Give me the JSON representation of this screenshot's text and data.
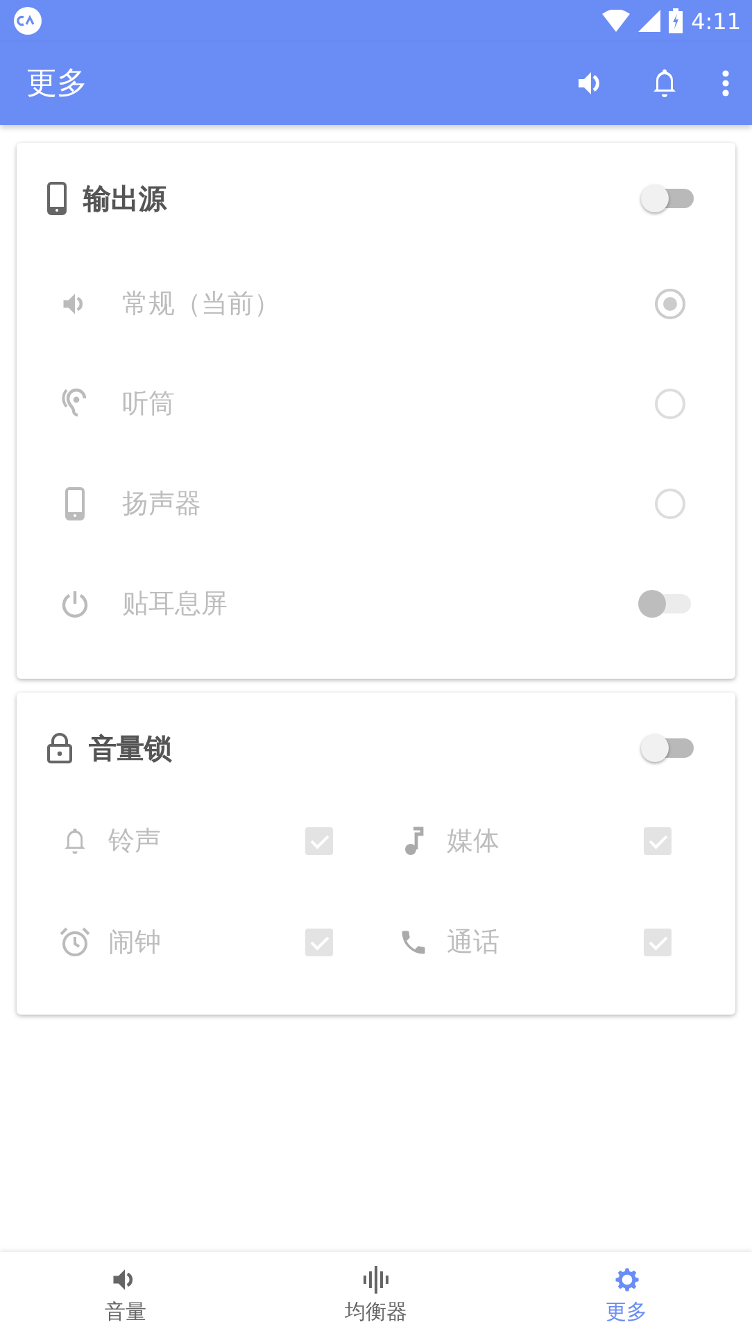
{
  "status_bar": {
    "time": "4:11"
  },
  "app_bar": {
    "title": "更多"
  },
  "output_source": {
    "title": "输出源",
    "on": false,
    "items": [
      {
        "kind": "radio",
        "label": "常规（当前）",
        "selected": true
      },
      {
        "kind": "radio",
        "label": "听筒",
        "selected": false
      },
      {
        "kind": "radio",
        "label": "扬声器",
        "selected": false
      },
      {
        "kind": "switch",
        "label": "贴耳息屏",
        "on": false
      }
    ]
  },
  "volume_lock": {
    "title": "音量锁",
    "on": false,
    "items": [
      {
        "label": "铃声",
        "checked": true
      },
      {
        "label": "媒体",
        "checked": true
      },
      {
        "label": "闹钟",
        "checked": true
      },
      {
        "label": "通话",
        "checked": true
      }
    ]
  },
  "tabs": [
    {
      "label": "音量",
      "selected": false
    },
    {
      "label": "均衡器",
      "selected": false
    },
    {
      "label": "更多",
      "selected": true
    }
  ]
}
